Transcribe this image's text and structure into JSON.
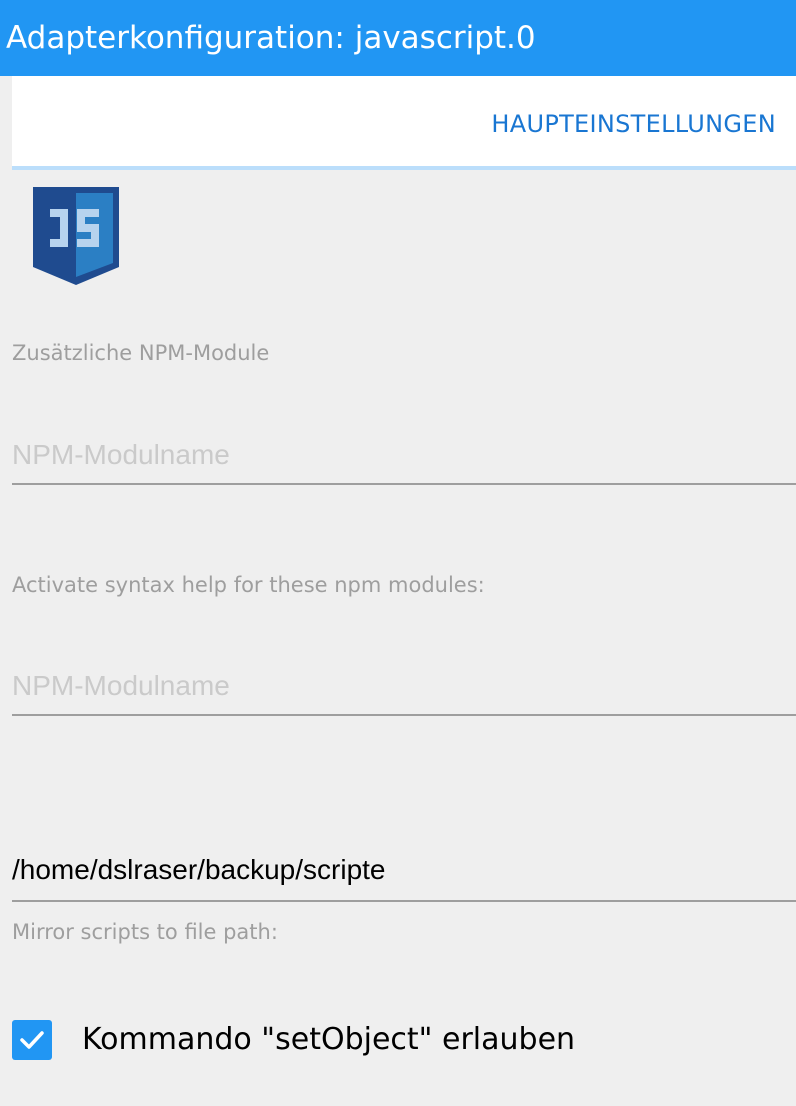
{
  "window": {
    "title": "Adapterkonfiguration: javascript.0"
  },
  "tabs": [
    {
      "label": "HAUPTEINSTELLUNGEN"
    }
  ],
  "logo": {
    "icon": "javascript-logo-icon",
    "text": "JS",
    "colors": {
      "shield": "#1f4b8f",
      "inner": "#2b7fc4"
    }
  },
  "npm_modules": {
    "label": "Zusätzliche NPM-Module",
    "placeholder": "NPM-Modulname"
  },
  "syntax_help": {
    "label": "Activate syntax help for these npm modules:",
    "placeholder": "NPM-Modulname"
  },
  "mirror": {
    "value": "/home/dslraser/backup/scripte",
    "label": "Mirror scripts to file path:"
  },
  "set_object": {
    "label": "Kommando \"setObject\" erlauben",
    "checked": true
  },
  "colors": {
    "accent": "#2196f3",
    "tab_text": "#1976d2",
    "tab_indicator": "#bbdefb"
  }
}
